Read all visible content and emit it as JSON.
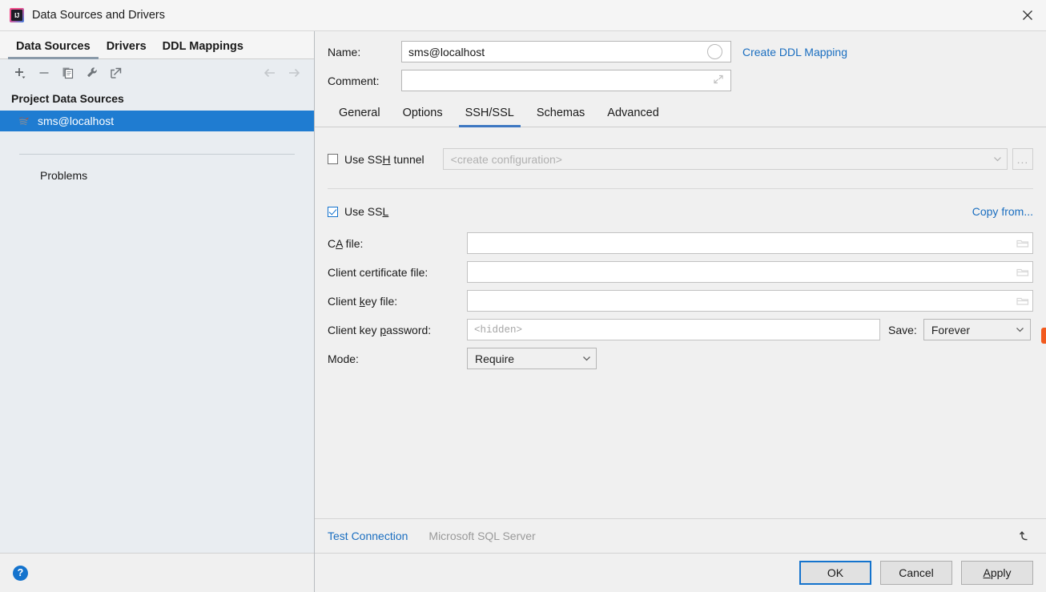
{
  "window": {
    "title": "Data Sources and Drivers",
    "app_icon": "intellij-idea-icon",
    "close_icon": "close-icon"
  },
  "sidebar": {
    "tabs": [
      {
        "label": "Data Sources",
        "active": true
      },
      {
        "label": "Drivers",
        "active": false
      },
      {
        "label": "DDL Mappings",
        "active": false
      }
    ],
    "toolbar": [
      {
        "name": "add-data-source-button",
        "icon": "plus-icon"
      },
      {
        "name": "remove-data-source-button",
        "icon": "minus-icon"
      },
      {
        "name": "duplicate-data-source-button",
        "icon": "copy-icon"
      },
      {
        "name": "edit-driver-button",
        "icon": "wrench-icon"
      },
      {
        "name": "jump-to-source-button",
        "icon": "external-link-icon"
      },
      {
        "name": "navigate-back-button",
        "icon": "arrow-left-icon"
      },
      {
        "name": "navigate-forward-button",
        "icon": "arrow-right-icon"
      }
    ],
    "group_title": "Project Data Sources",
    "items": [
      {
        "label": "sms@localhost",
        "icon": "sql-server-icon",
        "selected": true
      }
    ],
    "problems_label": "Problems",
    "help_icon": "help-icon",
    "help_glyph": "?"
  },
  "details": {
    "name_label": "Name:",
    "name_value": "sms@localhost",
    "name_indicator_icon": "sync-circle-icon",
    "comment_label": "Comment:",
    "comment_value": "",
    "comment_expand_icon": "expand-icon",
    "create_ddl_mapping_link": "Create DDL Mapping",
    "tabs": [
      {
        "label": "General",
        "active": false
      },
      {
        "label": "Options",
        "active": false
      },
      {
        "label": "SSH/SSL",
        "active": true
      },
      {
        "label": "Schemas",
        "active": false
      },
      {
        "label": "Advanced",
        "active": false
      }
    ]
  },
  "ssh": {
    "use_ssh_tunnel_label_pre": "Use SS",
    "use_ssh_tunnel_label_mn": "H",
    "use_ssh_tunnel_label_post": " tunnel",
    "use_ssh_tunnel_checked": false,
    "config_value": "<create configuration>",
    "config_disabled": true,
    "browse_button_label": "...",
    "chevron_icon": "chevron-down-icon"
  },
  "ssl": {
    "use_ssl_label_pre": "Use SS",
    "use_ssl_label_mn": "L",
    "use_ssl_label_post": "",
    "use_ssl_checked": true,
    "copy_from_link": "Copy from...",
    "ca_file_label_pre": "C",
    "ca_file_label_mn": "A",
    "ca_file_label_post": " file:",
    "ca_file_value": "",
    "client_cert_label": "Client certificate file:",
    "client_cert_value": "",
    "client_key_label_pre": "Client ",
    "client_key_label_mn": "k",
    "client_key_label_post": "ey file:",
    "client_key_value": "",
    "client_key_password_label_pre": "Client key ",
    "client_key_password_label_mn": "p",
    "client_key_password_label_post": "assword:",
    "client_key_password_value": "",
    "client_key_password_placeholder": "<hidden>",
    "save_label": "Save:",
    "save_value": "Forever",
    "mode_label": "Mode:",
    "mode_value": "Require",
    "folder_icon": "folder-icon"
  },
  "footer": {
    "test_connection_link": "Test Connection",
    "database_kind": "Microsoft SQL Server",
    "revert_icon": "revert-icon"
  },
  "buttons": {
    "ok_label": "OK",
    "cancel_label": "Cancel",
    "apply_label_mn": "A",
    "apply_label_post": "pply"
  },
  "colors": {
    "accent_blue": "#1473cd",
    "link_blue": "#1a6ec0",
    "selection_blue": "#1f7cd1",
    "tab_underline": "#3d77c2",
    "panel_bg": "#f0f0f0",
    "sidebar_bg": "#e9edf1",
    "edge_marker_orange": "#f25a1e"
  }
}
